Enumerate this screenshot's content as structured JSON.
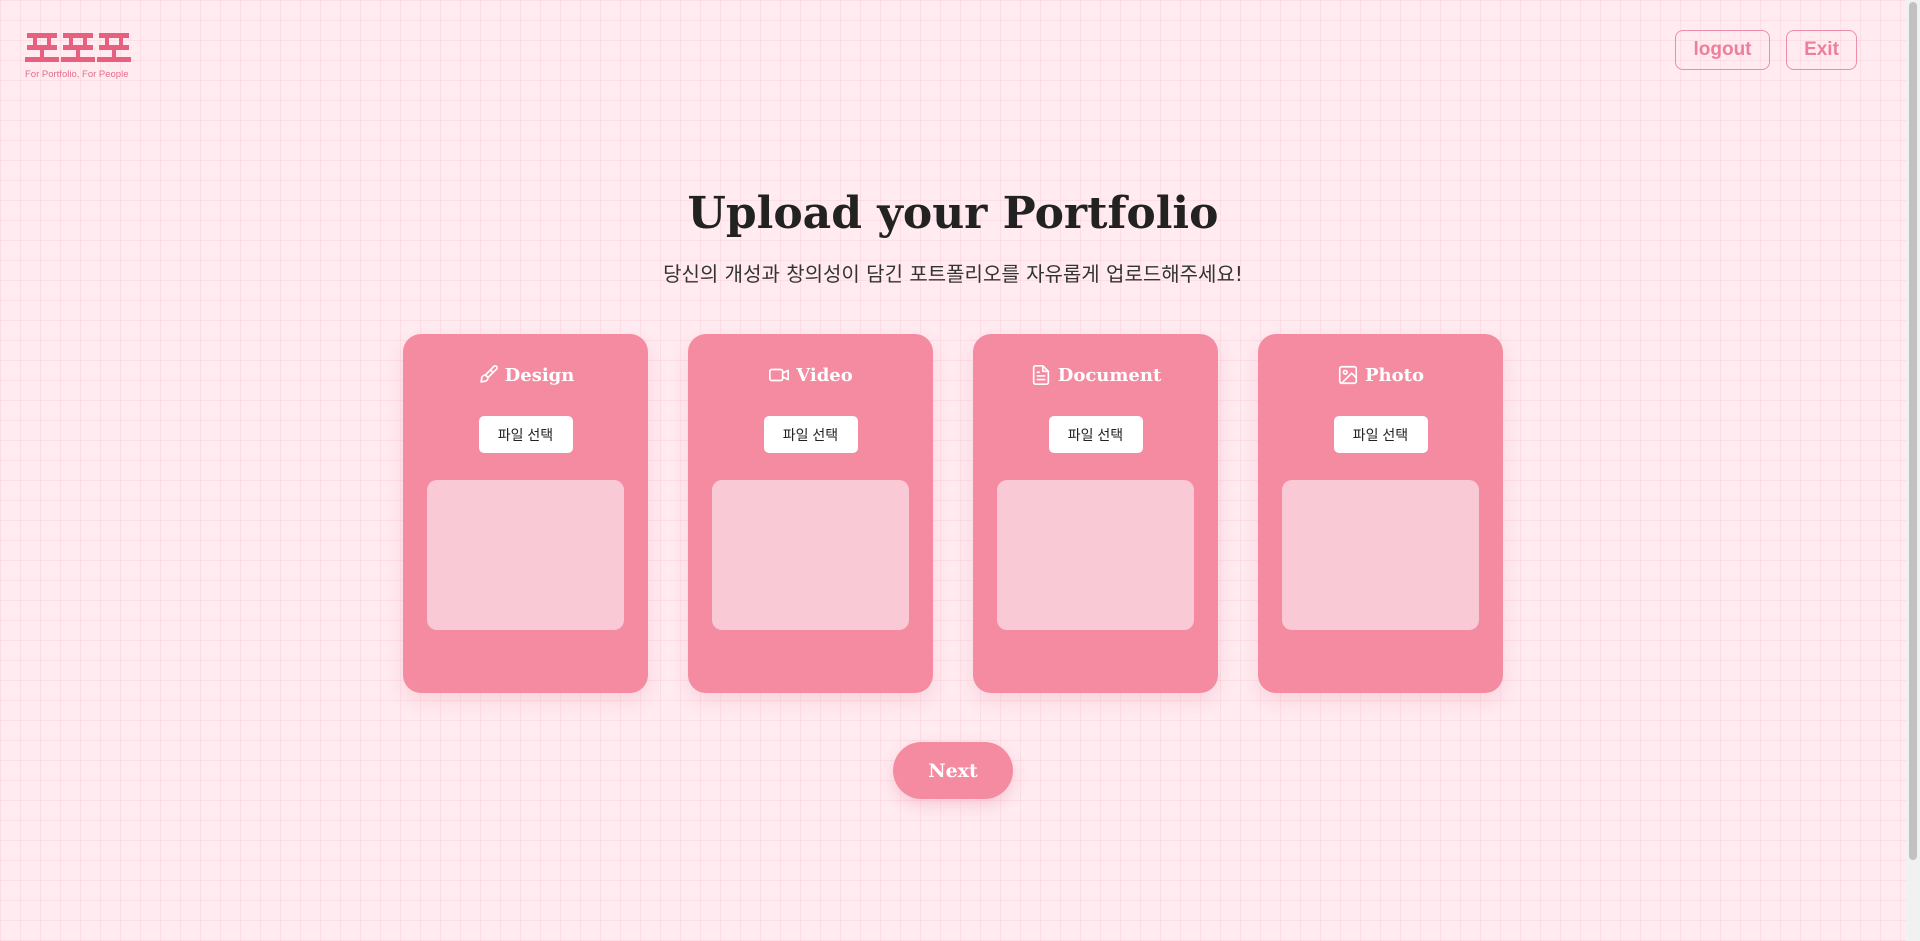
{
  "header": {
    "logo_tagline": "For Portfolio, For People",
    "logout_label": "logout",
    "exit_label": "Exit"
  },
  "main": {
    "title": "Upload your Portfolio",
    "subtitle": "당신의 개성과 창의성이 담긴 포트폴리오를 자유롭게 업로드해주세요!",
    "cards": [
      {
        "label": "Design",
        "icon": "paintbrush-icon",
        "file_button": "파일 선택"
      },
      {
        "label": "Video",
        "icon": "video-camera-icon",
        "file_button": "파일 선택"
      },
      {
        "label": "Document",
        "icon": "document-icon",
        "file_button": "파일 선택"
      },
      {
        "label": "Photo",
        "icon": "image-icon",
        "file_button": "파일 선택"
      }
    ],
    "next_label": "Next"
  },
  "colors": {
    "background": "#ffebf0",
    "accent": "#f48ba1",
    "preview": "#f9cad5",
    "logo": "#e8607f"
  }
}
